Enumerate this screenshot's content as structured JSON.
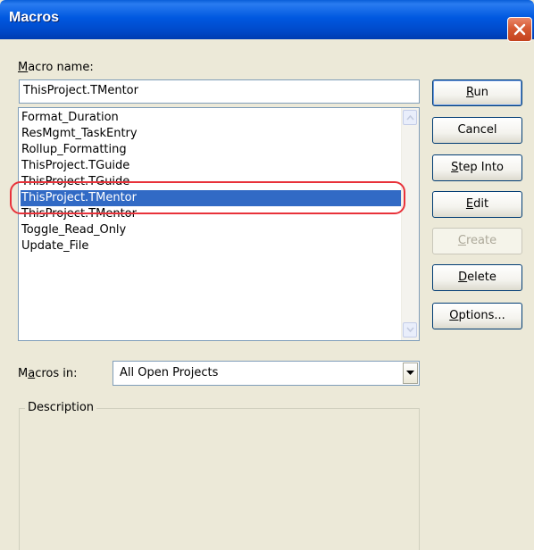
{
  "window": {
    "title": "Macros"
  },
  "macro_name": {
    "label_prefix": "",
    "label_underlined": "M",
    "label_rest": "acro name:",
    "value": "ThisProject.TMentor"
  },
  "macro_list": {
    "items": [
      {
        "label": "Format_Duration"
      },
      {
        "label": "ResMgmt_TaskEntry"
      },
      {
        "label": "Rollup_Formatting"
      },
      {
        "label": "ThisProject.TGuide"
      },
      {
        "label": "ThisProject.TGuide"
      },
      {
        "label": "ThisProject.TMentor",
        "selected": true
      },
      {
        "label": "ThisProject.TMentor"
      },
      {
        "label": "Toggle_Read_Only"
      },
      {
        "label": "Update_File"
      }
    ]
  },
  "buttons": {
    "run": {
      "underlined": "R",
      "rest": "un"
    },
    "cancel": {
      "label": "Cancel"
    },
    "step_into": {
      "underlined": "S",
      "rest": "tep Into"
    },
    "edit": {
      "underlined": "E",
      "rest": "dit"
    },
    "create": {
      "underlined": "C",
      "rest": "reate"
    },
    "delete": {
      "underlined": "D",
      "rest": "elete"
    },
    "options": {
      "underlined": "O",
      "rest": "ptions..."
    }
  },
  "macros_in": {
    "label_prefix": "M",
    "label_underlined": "a",
    "label_rest": "cros in:",
    "selected": "All Open Projects"
  },
  "description": {
    "legend": "Description"
  },
  "colors": {
    "title_bar": "#0054e3",
    "selection": "#316ac5",
    "highlight_annotation": "#e8323a"
  },
  "icons": {
    "close": "close-icon",
    "scroll_up": "chevron-up-icon",
    "scroll_down": "chevron-down-icon",
    "dropdown": "caret-down-icon"
  }
}
